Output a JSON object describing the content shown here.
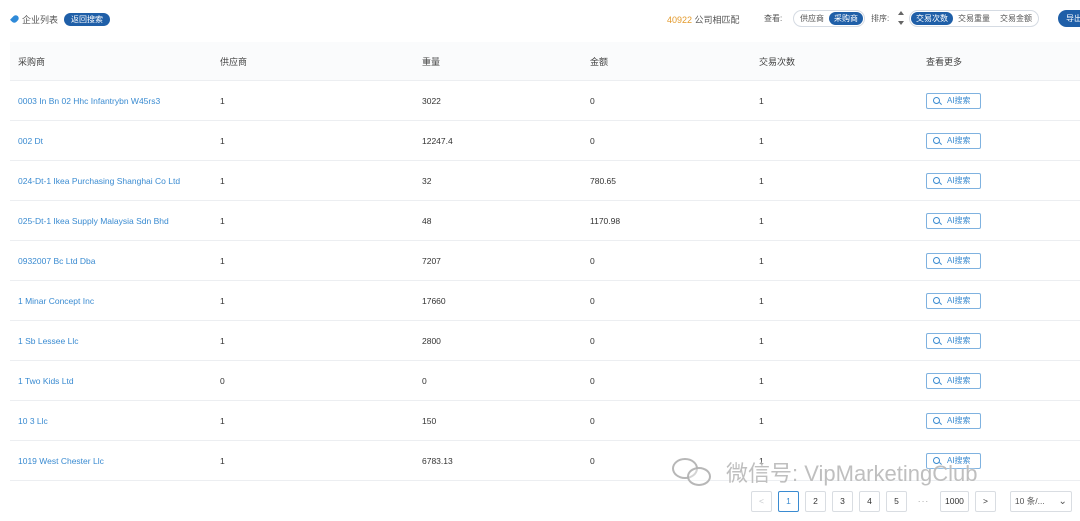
{
  "header": {
    "list_title": "企业列表",
    "back_button": "返回搜索",
    "match_count": "40922",
    "match_suffix": " 公司相匹配",
    "view_label": "查看:",
    "view_options": [
      {
        "label": "供应商",
        "active": false
      },
      {
        "label": "采购商",
        "active": true
      }
    ],
    "sort_label": "排序:",
    "sort_options": [
      {
        "label": "交易次数",
        "active": true
      },
      {
        "label": "交易重量",
        "active": false
      },
      {
        "label": "交易金额",
        "active": false
      }
    ],
    "export_button": "导出"
  },
  "table": {
    "columns": [
      "采购商",
      "供应商",
      "重量",
      "金额",
      "交易次数",
      "查看更多"
    ],
    "ai_button_label": "AI搜索",
    "rows": [
      {
        "buyer": "0003 In Bn 02 Hhc Infantrybn W45rs3",
        "suppliers": "1",
        "weight": "3022",
        "amount": "0",
        "trades": "1"
      },
      {
        "buyer": "002 Dt",
        "suppliers": "1",
        "weight": "12247.4",
        "amount": "0",
        "trades": "1"
      },
      {
        "buyer": "024-Dt-1 Ikea Purchasing Shanghai Co Ltd",
        "suppliers": "1",
        "weight": "32",
        "amount": "780.65",
        "trades": "1"
      },
      {
        "buyer": "025-Dt-1 Ikea Supply Malaysia Sdn Bhd",
        "suppliers": "1",
        "weight": "48",
        "amount": "1170.98",
        "trades": "1"
      },
      {
        "buyer": "0932007 Bc Ltd Dba",
        "suppliers": "1",
        "weight": "7207",
        "amount": "0",
        "trades": "1"
      },
      {
        "buyer": "1 Minar Concept Inc",
        "suppliers": "1",
        "weight": "17660",
        "amount": "0",
        "trades": "1"
      },
      {
        "buyer": "1 Sb Lessee Llc",
        "suppliers": "1",
        "weight": "2800",
        "amount": "0",
        "trades": "1"
      },
      {
        "buyer": "1 Two Kids Ltd",
        "suppliers": "0",
        "weight": "0",
        "amount": "0",
        "trades": "1"
      },
      {
        "buyer": "10 3 Llc",
        "suppliers": "1",
        "weight": "150",
        "amount": "0",
        "trades": "1"
      },
      {
        "buyer": "1019 West Chester Llc",
        "suppliers": "1",
        "weight": "6783.13",
        "amount": "0",
        "trades": "1"
      }
    ]
  },
  "pagination": {
    "prev": "<",
    "pages": [
      "1",
      "2",
      "3",
      "4",
      "5"
    ],
    "current": "1",
    "ellipsis": "···",
    "last": "1000",
    "next": ">",
    "page_size": "10 条/..."
  },
  "watermark": {
    "text": "微信号: VipMarketingClub"
  }
}
